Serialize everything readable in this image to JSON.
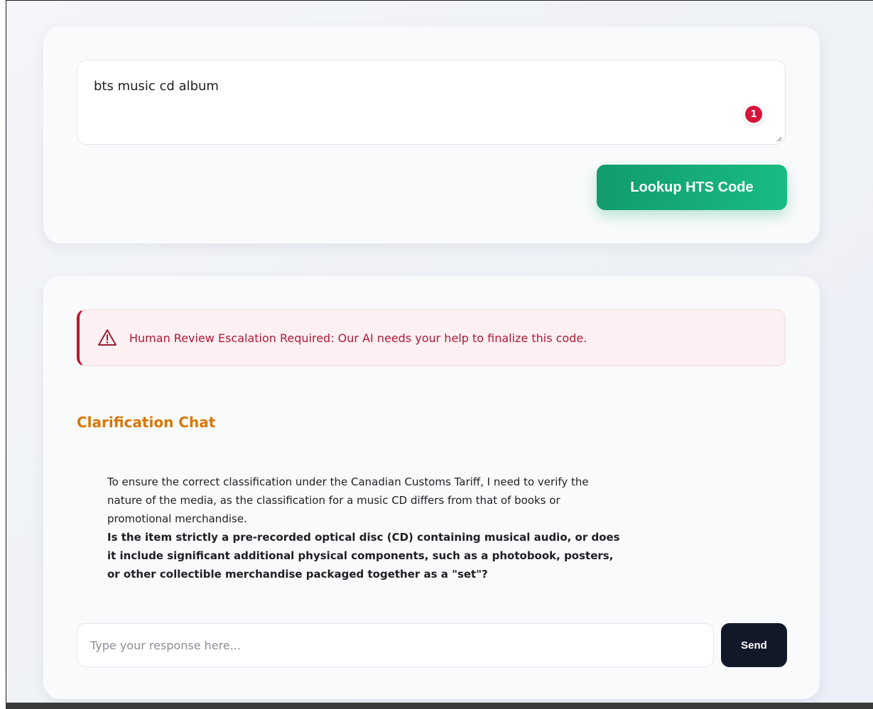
{
  "search": {
    "value": "bts music cd album",
    "notification_count": "1",
    "lookup_button_label": "Lookup HTS Code"
  },
  "alert": {
    "icon": "warning-triangle-icon",
    "text": "Human Review Escalation Required: Our AI needs your help to finalize this code."
  },
  "chat": {
    "title": "Clarification Chat",
    "message": {
      "intro": "To ensure the correct classification under the Canadian Customs Tariff, I need to verify the nature of the media, as the classification for a music CD differs from that of books or promotional merchandise.",
      "question": "Is the item strictly a pre-recorded optical disc (CD) containing musical audio, or does it include significant additional physical components, such as a photobook, posters, or other collectible merchandise packaged together as a \"set\"?"
    },
    "input_placeholder": "Type your response here...",
    "send_label": "Send"
  },
  "colors": {
    "primary_green": "#18bc83",
    "alert_red": "#c8102e",
    "chat_title_orange": "#d97706",
    "send_dark": "#111827"
  }
}
